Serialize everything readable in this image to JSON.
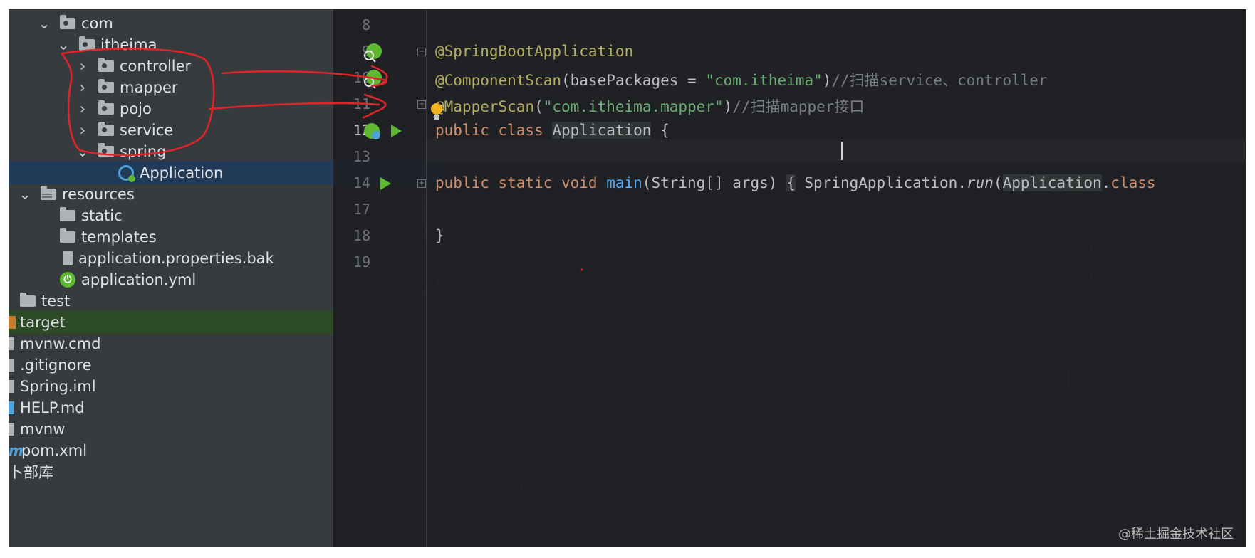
{
  "tree": {
    "items": [
      {
        "label": "com"
      },
      {
        "label": "itheima"
      },
      {
        "label": "controller"
      },
      {
        "label": "mapper"
      },
      {
        "label": "pojo"
      },
      {
        "label": "service"
      },
      {
        "label": "spring"
      },
      {
        "label": "Application"
      },
      {
        "label": "resources"
      },
      {
        "label": "static"
      },
      {
        "label": "templates"
      },
      {
        "label": "application.properties.bak"
      },
      {
        "label": "application.yml"
      },
      {
        "label": "test"
      },
      {
        "label": "target"
      },
      {
        "label": "mvnw.cmd"
      },
      {
        "label": ".gitignore"
      },
      {
        "label": "Spring.iml"
      },
      {
        "label": "HELP.md"
      },
      {
        "label": "mvnw"
      },
      {
        "label": "pom.xml"
      },
      {
        "label": "卜部库"
      }
    ]
  },
  "editor": {
    "line_numbers": [
      "8",
      "9",
      "10",
      "11",
      "12",
      "13",
      "14",
      "17",
      "18",
      "19"
    ],
    "current_line": "12",
    "code": {
      "l9_ann": "@SpringBootApplication",
      "l10_ann": "@ComponentScan",
      "l10_p1": "(basePackages = ",
      "l10_str": "\"com.itheima\"",
      "l10_p2": ")",
      "l10_cmt": "//扫描service、controller",
      "l11_ann_a": "@",
      "l11_ann_b": "MapperScan",
      "l11_p1": "(",
      "l11_str": "\"com.itheima.mapper\"",
      "l11_p2": ")",
      "l11_cmt": "//扫描mapper接口",
      "l12_kw": "public class ",
      "l12_cls": "Application",
      "l12_rest": " {",
      "l14_kw": "public static void ",
      "l14_fn": "main",
      "l14_p1": "(String[] args) ",
      "l14_brace": "{",
      "l14_p2": " SpringApplication.",
      "l14_run": "run",
      "l14_p3": "(",
      "l14_cls": "Application",
      "l14_p4": ".",
      "l14_kw2": "class",
      "l18": "}"
    }
  },
  "watermark": "@稀土掘金技术社区",
  "colors": {
    "annotation": "#b3ae60",
    "keyword": "#cf8e6d",
    "string": "#6aab73",
    "comment": "#7a7e85",
    "selection": "#203a57",
    "red_marker": "#e0242a"
  }
}
